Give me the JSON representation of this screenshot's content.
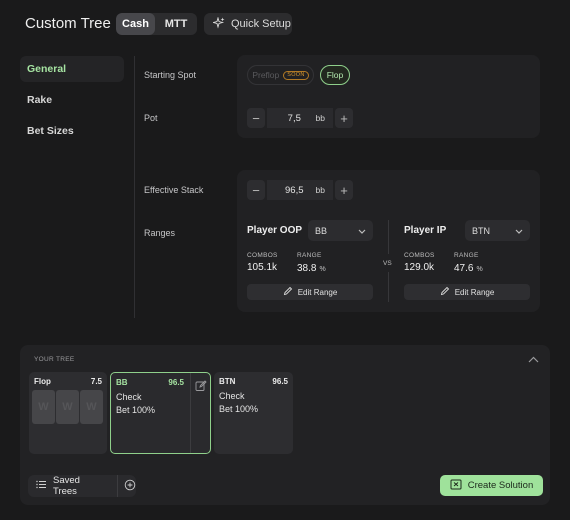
{
  "header": {
    "title": "Custom Tree",
    "game_modes": [
      "Cash",
      "MTT"
    ],
    "active_mode": "Cash",
    "quick_setup_label": "Quick Setup"
  },
  "sidebar": {
    "items": [
      {
        "label": "General",
        "active": true
      },
      {
        "label": "Rake",
        "active": false
      },
      {
        "label": "Bet Sizes",
        "active": false
      }
    ]
  },
  "general": {
    "starting_spot": {
      "label": "Starting Spot",
      "options": [
        {
          "label": "Preflop",
          "badge": "SOON",
          "enabled": false
        },
        {
          "label": "Flop",
          "selected": true
        }
      ]
    },
    "pot": {
      "label": "Pot",
      "value": "7,5",
      "unit": "bb"
    },
    "effective_stack": {
      "label": "Effective Stack",
      "value": "96,5",
      "unit": "bb"
    },
    "ranges": {
      "label": "Ranges",
      "vs_label": "VS",
      "players": [
        {
          "title": "Player OOP",
          "position": "BB",
          "combos_label": "COMBOS",
          "combos": "105.1k",
          "range_label": "RANGE",
          "range": "38.8",
          "range_unit": "%",
          "edit_label": "Edit Range"
        },
        {
          "title": "Player IP",
          "position": "BTN",
          "combos_label": "COMBOS",
          "combos": "129.0k",
          "range_label": "RANGE",
          "range": "47.6",
          "range_unit": "%",
          "edit_label": "Edit Range"
        }
      ]
    }
  },
  "tree": {
    "label": "YOUR TREE",
    "nodes": [
      {
        "title": "Flop",
        "stack": "7.5",
        "cards": [
          "W",
          "W",
          "W"
        ]
      },
      {
        "title": "BB",
        "stack": "96.5",
        "actions": [
          "Check",
          "Bet 100%"
        ],
        "selected": true
      },
      {
        "title": "BTN",
        "stack": "96.5",
        "actions": [
          "Check",
          "Bet 100%"
        ]
      }
    ],
    "saved_trees_label": "Saved Trees",
    "create_label": "Create Solution"
  },
  "colors": {
    "accent": "#9fe29b",
    "background": "#1a1a1b",
    "panel": "#212123",
    "badge": "#d6962e"
  }
}
